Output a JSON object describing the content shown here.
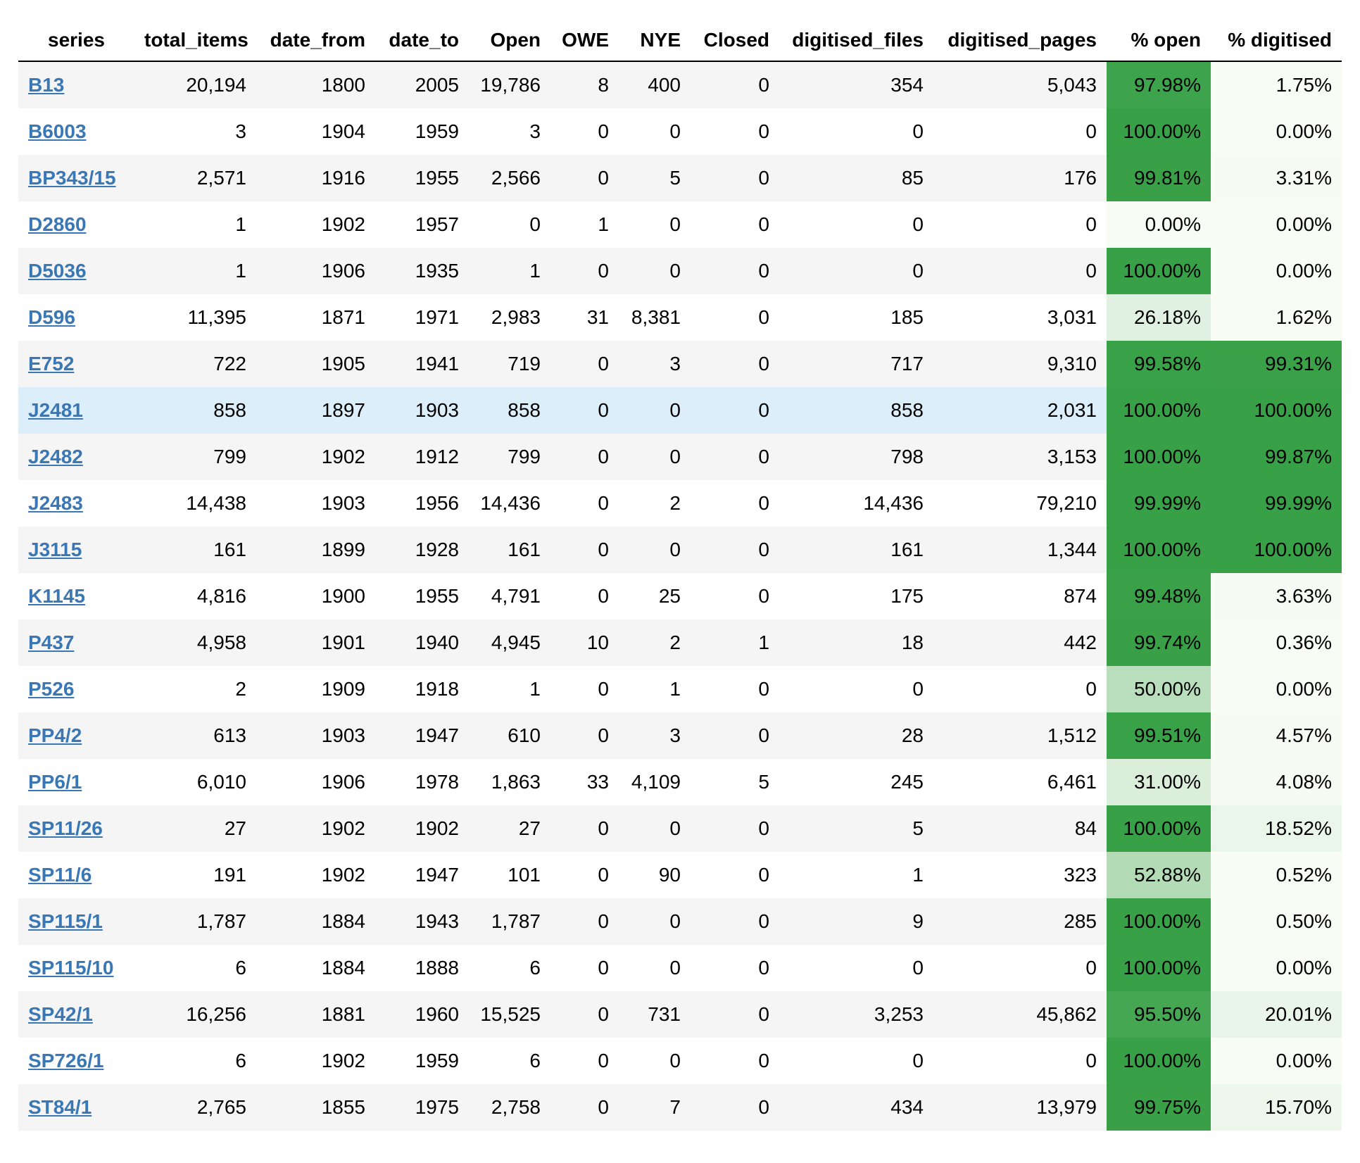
{
  "table": {
    "columns": [
      "series",
      "total_items",
      "date_from",
      "date_to",
      "Open",
      "OWE",
      "NYE",
      "Closed",
      "digitised_files",
      "digitised_pages",
      "% open",
      "% digitised"
    ],
    "highlighted_row": 7,
    "gradient": {
      "low": "#f7fcf5",
      "high": "#38a047",
      "text": "#000000"
    },
    "link_color": "#3a78b5",
    "rows": [
      {
        "series": "B13",
        "total_items": "20,194",
        "date_from": "1800",
        "date_to": "2005",
        "open": "19,786",
        "owe": "8",
        "nye": "400",
        "closed": "0",
        "digitised_files": "354",
        "digitised_pages": "5,043",
        "pct_open": "97.98%",
        "pct_open_value": 97.98,
        "pct_digitised": "1.75%",
        "pct_digitised_value": 1.75
      },
      {
        "series": "B6003",
        "total_items": "3",
        "date_from": "1904",
        "date_to": "1959",
        "open": "3",
        "owe": "0",
        "nye": "0",
        "closed": "0",
        "digitised_files": "0",
        "digitised_pages": "0",
        "pct_open": "100.00%",
        "pct_open_value": 100.0,
        "pct_digitised": "0.00%",
        "pct_digitised_value": 0.0
      },
      {
        "series": "BP343/15",
        "total_items": "2,571",
        "date_from": "1916",
        "date_to": "1955",
        "open": "2,566",
        "owe": "0",
        "nye": "5",
        "closed": "0",
        "digitised_files": "85",
        "digitised_pages": "176",
        "pct_open": "99.81%",
        "pct_open_value": 99.81,
        "pct_digitised": "3.31%",
        "pct_digitised_value": 3.31
      },
      {
        "series": "D2860",
        "total_items": "1",
        "date_from": "1902",
        "date_to": "1957",
        "open": "0",
        "owe": "1",
        "nye": "0",
        "closed": "0",
        "digitised_files": "0",
        "digitised_pages": "0",
        "pct_open": "0.00%",
        "pct_open_value": 0.0,
        "pct_digitised": "0.00%",
        "pct_digitised_value": 0.0
      },
      {
        "series": "D5036",
        "total_items": "1",
        "date_from": "1906",
        "date_to": "1935",
        "open": "1",
        "owe": "0",
        "nye": "0",
        "closed": "0",
        "digitised_files": "0",
        "digitised_pages": "0",
        "pct_open": "100.00%",
        "pct_open_value": 100.0,
        "pct_digitised": "0.00%",
        "pct_digitised_value": 0.0
      },
      {
        "series": "D596",
        "total_items": "11,395",
        "date_from": "1871",
        "date_to": "1971",
        "open": "2,983",
        "owe": "31",
        "nye": "8,381",
        "closed": "0",
        "digitised_files": "185",
        "digitised_pages": "3,031",
        "pct_open": "26.18%",
        "pct_open_value": 26.18,
        "pct_digitised": "1.62%",
        "pct_digitised_value": 1.62
      },
      {
        "series": "E752",
        "total_items": "722",
        "date_from": "1905",
        "date_to": "1941",
        "open": "719",
        "owe": "0",
        "nye": "3",
        "closed": "0",
        "digitised_files": "717",
        "digitised_pages": "9,310",
        "pct_open": "99.58%",
        "pct_open_value": 99.58,
        "pct_digitised": "99.31%",
        "pct_digitised_value": 99.31
      },
      {
        "series": "J2481",
        "total_items": "858",
        "date_from": "1897",
        "date_to": "1903",
        "open": "858",
        "owe": "0",
        "nye": "0",
        "closed": "0",
        "digitised_files": "858",
        "digitised_pages": "2,031",
        "pct_open": "100.00%",
        "pct_open_value": 100.0,
        "pct_digitised": "100.00%",
        "pct_digitised_value": 100.0
      },
      {
        "series": "J2482",
        "total_items": "799",
        "date_from": "1902",
        "date_to": "1912",
        "open": "799",
        "owe": "0",
        "nye": "0",
        "closed": "0",
        "digitised_files": "798",
        "digitised_pages": "3,153",
        "pct_open": "100.00%",
        "pct_open_value": 100.0,
        "pct_digitised": "99.87%",
        "pct_digitised_value": 99.87
      },
      {
        "series": "J2483",
        "total_items": "14,438",
        "date_from": "1903",
        "date_to": "1956",
        "open": "14,436",
        "owe": "0",
        "nye": "2",
        "closed": "0",
        "digitised_files": "14,436",
        "digitised_pages": "79,210",
        "pct_open": "99.99%",
        "pct_open_value": 99.99,
        "pct_digitised": "99.99%",
        "pct_digitised_value": 99.99
      },
      {
        "series": "J3115",
        "total_items": "161",
        "date_from": "1899",
        "date_to": "1928",
        "open": "161",
        "owe": "0",
        "nye": "0",
        "closed": "0",
        "digitised_files": "161",
        "digitised_pages": "1,344",
        "pct_open": "100.00%",
        "pct_open_value": 100.0,
        "pct_digitised": "100.00%",
        "pct_digitised_value": 100.0
      },
      {
        "series": "K1145",
        "total_items": "4,816",
        "date_from": "1900",
        "date_to": "1955",
        "open": "4,791",
        "owe": "0",
        "nye": "25",
        "closed": "0",
        "digitised_files": "175",
        "digitised_pages": "874",
        "pct_open": "99.48%",
        "pct_open_value": 99.48,
        "pct_digitised": "3.63%",
        "pct_digitised_value": 3.63
      },
      {
        "series": "P437",
        "total_items": "4,958",
        "date_from": "1901",
        "date_to": "1940",
        "open": "4,945",
        "owe": "10",
        "nye": "2",
        "closed": "1",
        "digitised_files": "18",
        "digitised_pages": "442",
        "pct_open": "99.74%",
        "pct_open_value": 99.74,
        "pct_digitised": "0.36%",
        "pct_digitised_value": 0.36
      },
      {
        "series": "P526",
        "total_items": "2",
        "date_from": "1909",
        "date_to": "1918",
        "open": "1",
        "owe": "0",
        "nye": "1",
        "closed": "0",
        "digitised_files": "0",
        "digitised_pages": "0",
        "pct_open": "50.00%",
        "pct_open_value": 50.0,
        "pct_digitised": "0.00%",
        "pct_digitised_value": 0.0
      },
      {
        "series": "PP4/2",
        "total_items": "613",
        "date_from": "1903",
        "date_to": "1947",
        "open": "610",
        "owe": "0",
        "nye": "3",
        "closed": "0",
        "digitised_files": "28",
        "digitised_pages": "1,512",
        "pct_open": "99.51%",
        "pct_open_value": 99.51,
        "pct_digitised": "4.57%",
        "pct_digitised_value": 4.57
      },
      {
        "series": "PP6/1",
        "total_items": "6,010",
        "date_from": "1906",
        "date_to": "1978",
        "open": "1,863",
        "owe": "33",
        "nye": "4,109",
        "closed": "5",
        "digitised_files": "245",
        "digitised_pages": "6,461",
        "pct_open": "31.00%",
        "pct_open_value": 31.0,
        "pct_digitised": "4.08%",
        "pct_digitised_value": 4.08
      },
      {
        "series": "SP11/26",
        "total_items": "27",
        "date_from": "1902",
        "date_to": "1902",
        "open": "27",
        "owe": "0",
        "nye": "0",
        "closed": "0",
        "digitised_files": "5",
        "digitised_pages": "84",
        "pct_open": "100.00%",
        "pct_open_value": 100.0,
        "pct_digitised": "18.52%",
        "pct_digitised_value": 18.52
      },
      {
        "series": "SP11/6",
        "total_items": "191",
        "date_from": "1902",
        "date_to": "1947",
        "open": "101",
        "owe": "0",
        "nye": "90",
        "closed": "0",
        "digitised_files": "1",
        "digitised_pages": "323",
        "pct_open": "52.88%",
        "pct_open_value": 52.88,
        "pct_digitised": "0.52%",
        "pct_digitised_value": 0.52
      },
      {
        "series": "SP115/1",
        "total_items": "1,787",
        "date_from": "1884",
        "date_to": "1943",
        "open": "1,787",
        "owe": "0",
        "nye": "0",
        "closed": "0",
        "digitised_files": "9",
        "digitised_pages": "285",
        "pct_open": "100.00%",
        "pct_open_value": 100.0,
        "pct_digitised": "0.50%",
        "pct_digitised_value": 0.5
      },
      {
        "series": "SP115/10",
        "total_items": "6",
        "date_from": "1884",
        "date_to": "1888",
        "open": "6",
        "owe": "0",
        "nye": "0",
        "closed": "0",
        "digitised_files": "0",
        "digitised_pages": "0",
        "pct_open": "100.00%",
        "pct_open_value": 100.0,
        "pct_digitised": "0.00%",
        "pct_digitised_value": 0.0
      },
      {
        "series": "SP42/1",
        "total_items": "16,256",
        "date_from": "1881",
        "date_to": "1960",
        "open": "15,525",
        "owe": "0",
        "nye": "731",
        "closed": "0",
        "digitised_files": "3,253",
        "digitised_pages": "45,862",
        "pct_open": "95.50%",
        "pct_open_value": 95.5,
        "pct_digitised": "20.01%",
        "pct_digitised_value": 20.01
      },
      {
        "series": "SP726/1",
        "total_items": "6",
        "date_from": "1902",
        "date_to": "1959",
        "open": "6",
        "owe": "0",
        "nye": "0",
        "closed": "0",
        "digitised_files": "0",
        "digitised_pages": "0",
        "pct_open": "100.00%",
        "pct_open_value": 100.0,
        "pct_digitised": "0.00%",
        "pct_digitised_value": 0.0
      },
      {
        "series": "ST84/1",
        "total_items": "2,765",
        "date_from": "1855",
        "date_to": "1975",
        "open": "2,758",
        "owe": "0",
        "nye": "7",
        "closed": "0",
        "digitised_files": "434",
        "digitised_pages": "13,979",
        "pct_open": "99.75%",
        "pct_open_value": 99.75,
        "pct_digitised": "15.70%",
        "pct_digitised_value": 15.7
      }
    ]
  }
}
